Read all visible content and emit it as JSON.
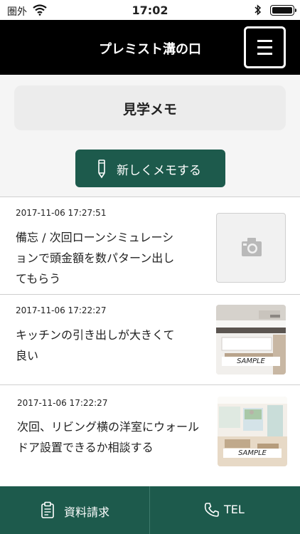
{
  "status_bar": {
    "carrier": "圏外",
    "time": "17:02"
  },
  "header": {
    "title": "プレミスト溝の口"
  },
  "memo_section": {
    "title": "見学メモ",
    "new_memo_label": "新しくメモする"
  },
  "memos": [
    {
      "date": "2017-11-06 17:27:51",
      "text": "備忘 / 次回ローンシミュレーションで頭金額を数パターン出してもらう",
      "thumbnail": "camera-placeholder"
    },
    {
      "date": "2017-11-06 17:22:27",
      "text": "キッチンの引き出しが大きくて良い",
      "thumbnail": "kitchen-photo",
      "thumbnail_label": "SAMPLE"
    },
    {
      "date": "2017-11-06 17:22:27",
      "text": "次回、リビング横の洋室にウォールドア設置できるか相談する",
      "thumbnail": "living-room-photo",
      "thumbnail_label": "SAMPLE"
    }
  ],
  "bottom_bar": {
    "request_label": "資料請求",
    "tel_label": "TEL"
  },
  "colors": {
    "accent": "#1d5a4c",
    "header_bg": "#000000"
  }
}
